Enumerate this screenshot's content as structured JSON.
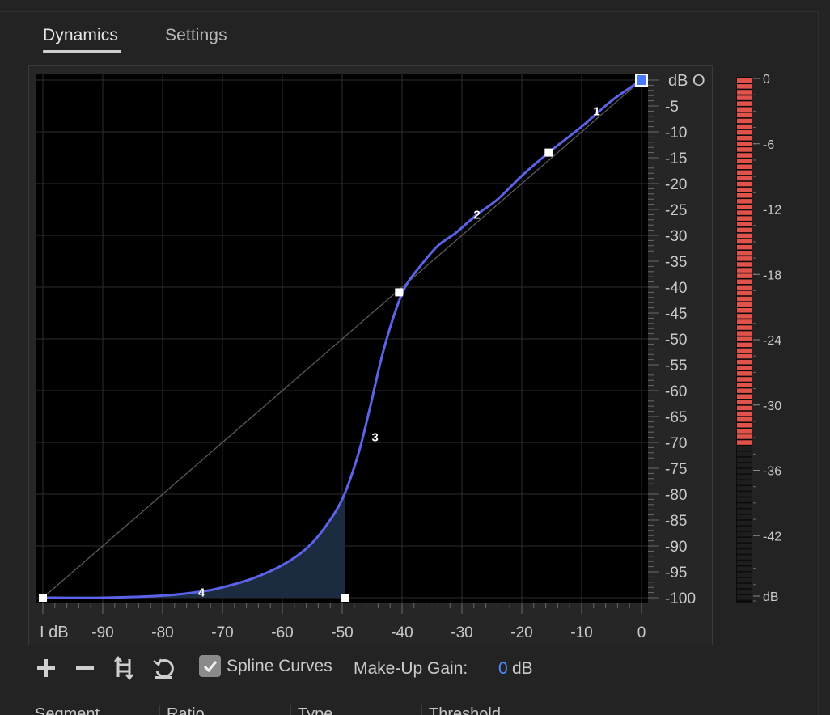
{
  "tabs": [
    {
      "label": "Dynamics",
      "active": true
    },
    {
      "label": "Settings",
      "active": false
    }
  ],
  "graph": {
    "x_axis_title": "I dB",
    "y_axis_title": "dB O",
    "x_ticks": [
      "-90",
      "-80",
      "-70",
      "-60",
      "-50",
      "-40",
      "-30",
      "-20",
      "-10",
      "0"
    ],
    "y_ticks": [
      "-5",
      "-10",
      "-15",
      "-20",
      "-25",
      "-30",
      "-35",
      "-40",
      "-45",
      "-50",
      "-55",
      "-60",
      "-65",
      "-70",
      "-75",
      "-80",
      "-85",
      "-90",
      "-95",
      "-100"
    ],
    "x_range": [
      -100,
      0
    ],
    "y_range": [
      -100,
      0
    ],
    "curve_color": "#5b63e8",
    "fill_color": "#1c2b3f",
    "segment_labels": [
      {
        "label": "1",
        "x": -7.5,
        "y": -6
      },
      {
        "label": "2",
        "x": -27.5,
        "y": -26
      },
      {
        "label": "3",
        "x": -44.5,
        "y": -69
      },
      {
        "label": "4",
        "x": -73.5,
        "y": -99
      }
    ],
    "control_points": [
      {
        "x": -100,
        "y": -100
      },
      {
        "x": -49.5,
        "y": -100
      },
      {
        "x": -40.5,
        "y": -41
      },
      {
        "x": -15.5,
        "y": -14
      },
      {
        "x": 0,
        "y": 0
      }
    ],
    "curve_points": [
      [
        -100,
        -100
      ],
      [
        -90,
        -100
      ],
      [
        -80,
        -99.6
      ],
      [
        -73.5,
        -98.8
      ],
      [
        -70,
        -98
      ],
      [
        -65,
        -96.3
      ],
      [
        -60,
        -93.7
      ],
      [
        -56,
        -90.5
      ],
      [
        -53,
        -86.6
      ],
      [
        -50,
        -81
      ],
      [
        -47.5,
        -73
      ],
      [
        -45.5,
        -64
      ],
      [
        -43.5,
        -54
      ],
      [
        -41.5,
        -46
      ],
      [
        -39.5,
        -40
      ],
      [
        -37,
        -36
      ],
      [
        -34,
        -32
      ],
      [
        -31,
        -29.5
      ],
      [
        -27.5,
        -26
      ],
      [
        -24,
        -23
      ],
      [
        -20,
        -18.5
      ],
      [
        -15.5,
        -14
      ],
      [
        -10,
        -9
      ],
      [
        -5,
        -4
      ],
      [
        0,
        0
      ]
    ],
    "fill_until_x": -49.5
  },
  "meter": {
    "labels": [
      "0",
      "-6",
      "-12",
      "-18",
      "-24",
      "-30",
      "-36",
      "-42",
      "dB"
    ],
    "range": [
      -48,
      0
    ],
    "level_db": -33.5,
    "active_color": "#e0524a"
  },
  "toolbar": {
    "add_icon": "plus-icon",
    "remove_icon": "minus-icon",
    "invert_icon": "invert-points-icon",
    "reset_icon": "reset-icon",
    "spline_checked": true,
    "spline_label": "Spline Curves",
    "makeup_label": "Make-Up Gain:",
    "makeup_value": "0",
    "makeup_unit": "dB"
  },
  "table": {
    "columns": [
      "Segment",
      "Ratio",
      "Type",
      "Threshold"
    ]
  }
}
